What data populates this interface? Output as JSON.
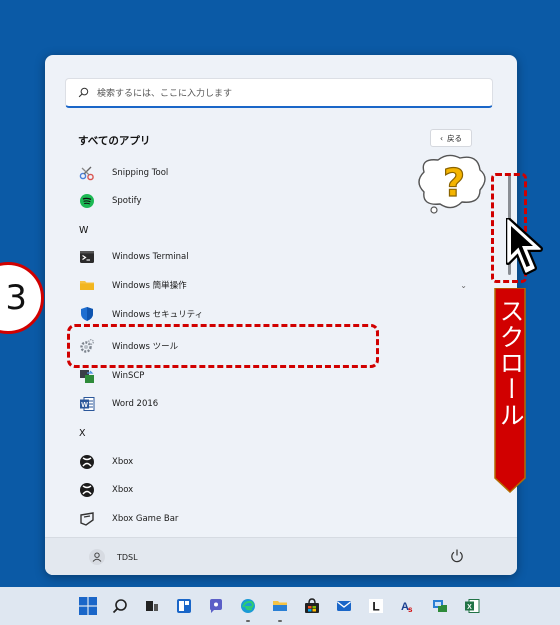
{
  "search": {
    "placeholder": "検索するには、ここに入力します"
  },
  "all_apps": {
    "title": "すべてのアプリ",
    "back_label": "戻る"
  },
  "apps": [
    {
      "name": "Snipping Tool",
      "icon": "snipping-tool-icon"
    },
    {
      "name": "Spotify",
      "icon": "spotify-icon"
    },
    {
      "letter": "W"
    },
    {
      "name": "Windows Terminal",
      "icon": "terminal-icon"
    },
    {
      "name": "Windows 簡単操作",
      "icon": "folder-icon",
      "expandable": true
    },
    {
      "name": "Windows セキュリティ",
      "icon": "shield-icon"
    },
    {
      "name": "Windows ツール",
      "icon": "gear-icon"
    },
    {
      "name": "WinSCP",
      "icon": "winscp-icon"
    },
    {
      "name": "Word 2016",
      "icon": "word-icon"
    },
    {
      "letter": "X"
    },
    {
      "name": "Xbox",
      "icon": "xbox-icon"
    },
    {
      "name": "Xbox",
      "icon": "xbox-icon"
    },
    {
      "name": "Xbox Game Bar",
      "icon": "xbox-game-bar-icon"
    }
  ],
  "user": {
    "name": "TDSL"
  },
  "annotations": {
    "step_number": "3",
    "scroll_label": "スクロール"
  },
  "colors": {
    "accent": "#1a66c8",
    "annotation_red": "#d10000",
    "desktop": "#0b5aa6"
  }
}
